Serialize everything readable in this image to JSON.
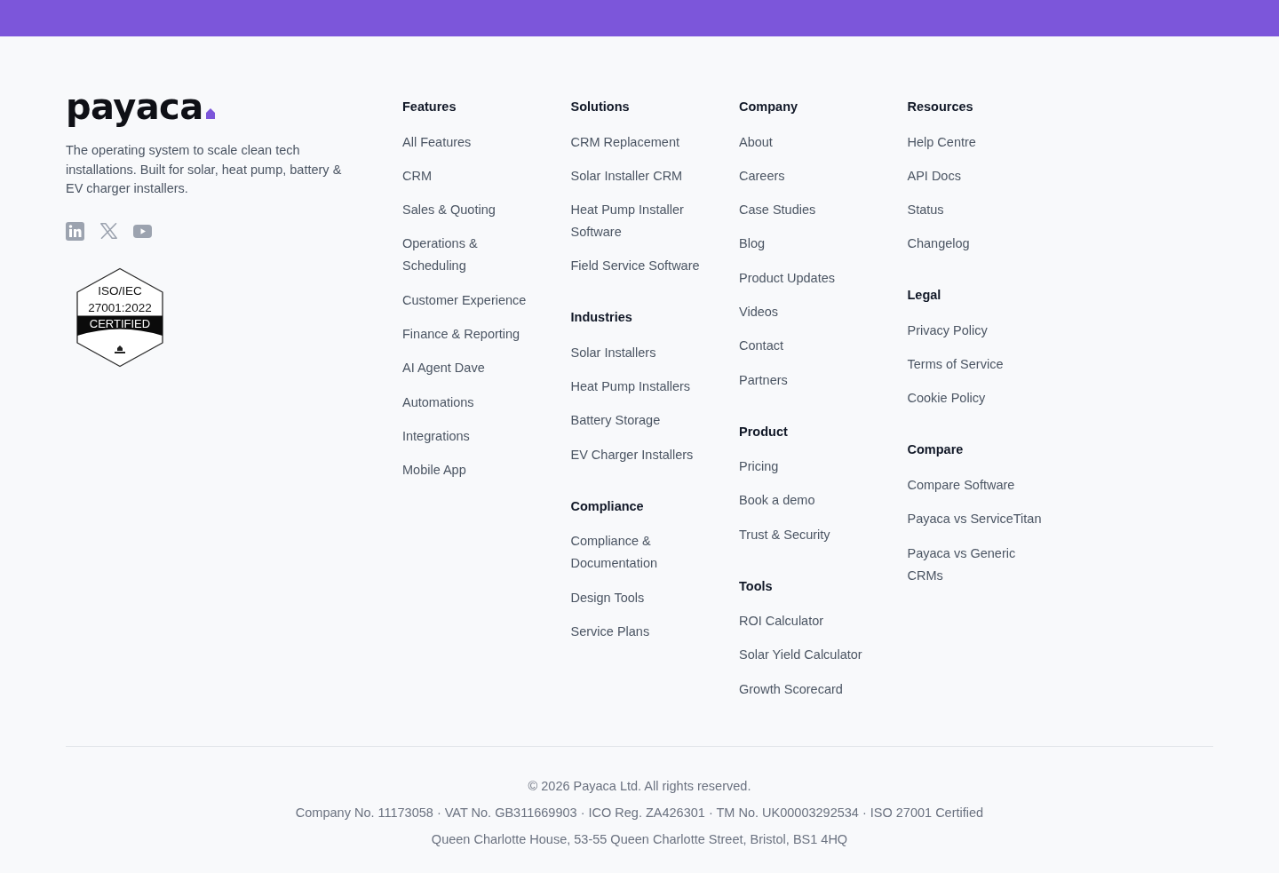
{
  "brand": {
    "logo_text": "payaca",
    "tagline": "The operating system to scale clean tech installations. Built for solar, heat pump, battery & EV charger installers.",
    "social_links": [
      {
        "kind": "linkedin"
      },
      {
        "kind": "x"
      },
      {
        "kind": "youtube"
      }
    ],
    "certification_badge": {
      "lines": [
        "ISO/IEC",
        "27001:2022"
      ],
      "banner": "CERTIFIED"
    }
  },
  "link_columns": [
    {
      "groups": [
        {
          "heading": "Features",
          "links": [
            "All Features",
            "CRM",
            "Sales & Quoting",
            "Operations & Scheduling",
            "Customer Experience",
            "Finance & Reporting",
            "AI Agent Dave",
            "Automations",
            "Integrations",
            "Mobile App"
          ]
        }
      ]
    },
    {
      "groups": [
        {
          "heading": "Solutions",
          "links": [
            "CRM Replacement",
            "Solar Installer CRM",
            "Heat Pump Installer Software",
            "Field Service Software"
          ]
        },
        {
          "heading": "Industries",
          "links": [
            "Solar Installers",
            "Heat Pump Installers",
            "Battery Storage",
            "EV Charger Installers"
          ]
        },
        {
          "heading": "Compliance",
          "links": [
            "Compliance & Documentation",
            "Design Tools",
            "Service Plans"
          ]
        }
      ]
    },
    {
      "groups": [
        {
          "heading": "Company",
          "links": [
            "About",
            "Careers",
            "Case Studies",
            "Blog",
            "Product Updates",
            "Videos",
            "Contact",
            "Partners"
          ]
        },
        {
          "heading": "Product",
          "links": [
            "Pricing",
            "Book a demo",
            "Trust & Security"
          ]
        },
        {
          "heading": "Tools",
          "links": [
            "ROI Calculator",
            "Solar Yield Calculator",
            "Growth Scorecard"
          ]
        }
      ]
    },
    {
      "groups": [
        {
          "heading": "Resources",
          "links": [
            "Help Centre",
            "API Docs",
            "Status",
            "Changelog"
          ]
        },
        {
          "heading": "Legal",
          "links": [
            "Privacy Policy",
            "Terms of Service",
            "Cookie Policy"
          ]
        },
        {
          "heading": "Compare",
          "links": [
            "Compare Software",
            "Payaca vs ServiceTitan",
            "Payaca vs Generic CRMs"
          ]
        }
      ]
    }
  ],
  "bottom": {
    "copyright": "© 2026 Payaca Ltd. All rights reserved.",
    "registration": "Company No. 11173058 · VAT No. GB311669903 · ICO Reg. ZA426301 · TM No. UK00003292534 · ISO 27001 Certified",
    "address": "Queen Charlotte House, 53-55 Queen Charlotte Street, Bristol, BS1 4HQ"
  }
}
